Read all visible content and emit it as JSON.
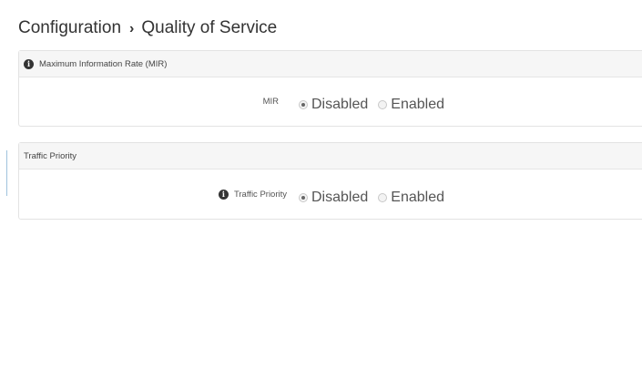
{
  "breadcrumb": {
    "parent": "Configuration",
    "separator": "›",
    "current": "Quality of Service"
  },
  "mir_panel": {
    "title": "Maximum Information Rate (MIR)",
    "info_icon": "info-circle-icon",
    "field_label": "MIR",
    "options": [
      {
        "label": "Disabled",
        "checked": true
      },
      {
        "label": "Enabled",
        "checked": false
      }
    ]
  },
  "traffic_panel": {
    "title": "Traffic Priority",
    "info_icon": "info-circle-icon",
    "field_label": "Traffic Priority",
    "options": [
      {
        "label": "Disabled",
        "checked": true
      },
      {
        "label": "Enabled",
        "checked": false
      }
    ]
  }
}
